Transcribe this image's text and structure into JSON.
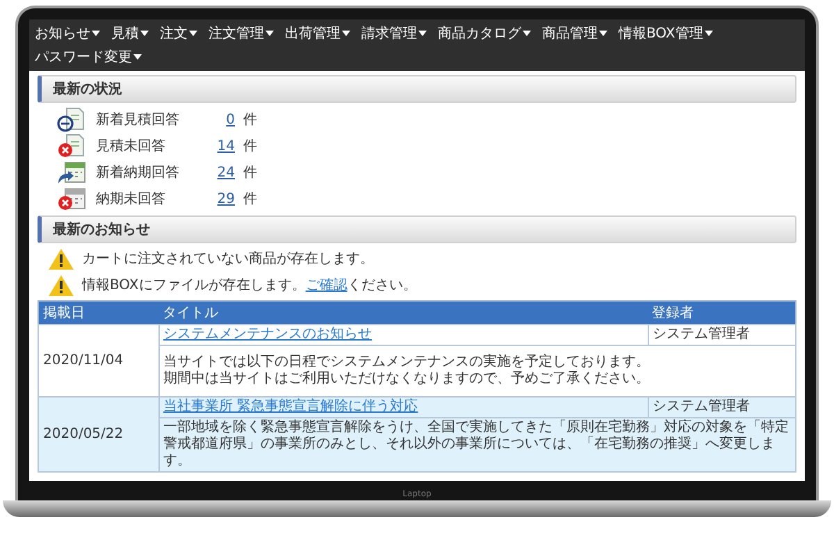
{
  "nav": [
    {
      "label": "お知らせ"
    },
    {
      "label": "見積"
    },
    {
      "label": "注文"
    },
    {
      "label": "注文管理"
    },
    {
      "label": "出荷管理"
    },
    {
      "label": "請求管理"
    },
    {
      "label": "商品カタログ"
    },
    {
      "label": "商品管理"
    },
    {
      "label": "情報BOX管理"
    },
    {
      "label": "パスワード変更"
    }
  ],
  "status_section": {
    "title": "最新の状況",
    "items": [
      {
        "kind": "doc-new",
        "label": "新着見積回答",
        "count": "0",
        "unit": "件"
      },
      {
        "kind": "doc-unanswered",
        "label": "見積未回答",
        "count": "14",
        "unit": "件"
      },
      {
        "kind": "calendar-new",
        "label": "新着納期回答",
        "count": "24",
        "unit": "件"
      },
      {
        "kind": "calendar-unanswered",
        "label": "納期未回答",
        "count": "29",
        "unit": "件"
      }
    ]
  },
  "news_section": {
    "title": "最新のお知らせ",
    "alerts": [
      {
        "text": "カートに注文されていない商品が存在します。"
      },
      {
        "text": "情報BOXにファイルが存在します。",
        "link": "ご確認",
        "after": "ください。"
      }
    ],
    "table": {
      "columns": [
        "掲載日",
        "タイトル",
        "登録者"
      ],
      "rows": [
        {
          "date": "2020/11/04",
          "title": "システムメンテナンスのお知らせ",
          "author": "システム管理者",
          "body": [
            "当サイトでは以下の日程でシステムメンテナンスの実施を予定しております。",
            "期間中は当サイトはご利用いただけなくなりますので、予めご了承ください。"
          ]
        },
        {
          "date": "2020/05/22",
          "title": "当社事業所 緊急事態宣言解除に伴う対応",
          "author": "システム管理者",
          "body": [
            "一部地域を除く緊急事態宣言解除をうけ、全国で実施してきた「原則在宅勤務」対応の対象を「特定警戒都道府県」の事業所のみとし、それ以外の事業所については、「在宅勤務の推奨」へ変更します。"
          ]
        }
      ]
    }
  },
  "laptop": {
    "label": "Laptop"
  }
}
